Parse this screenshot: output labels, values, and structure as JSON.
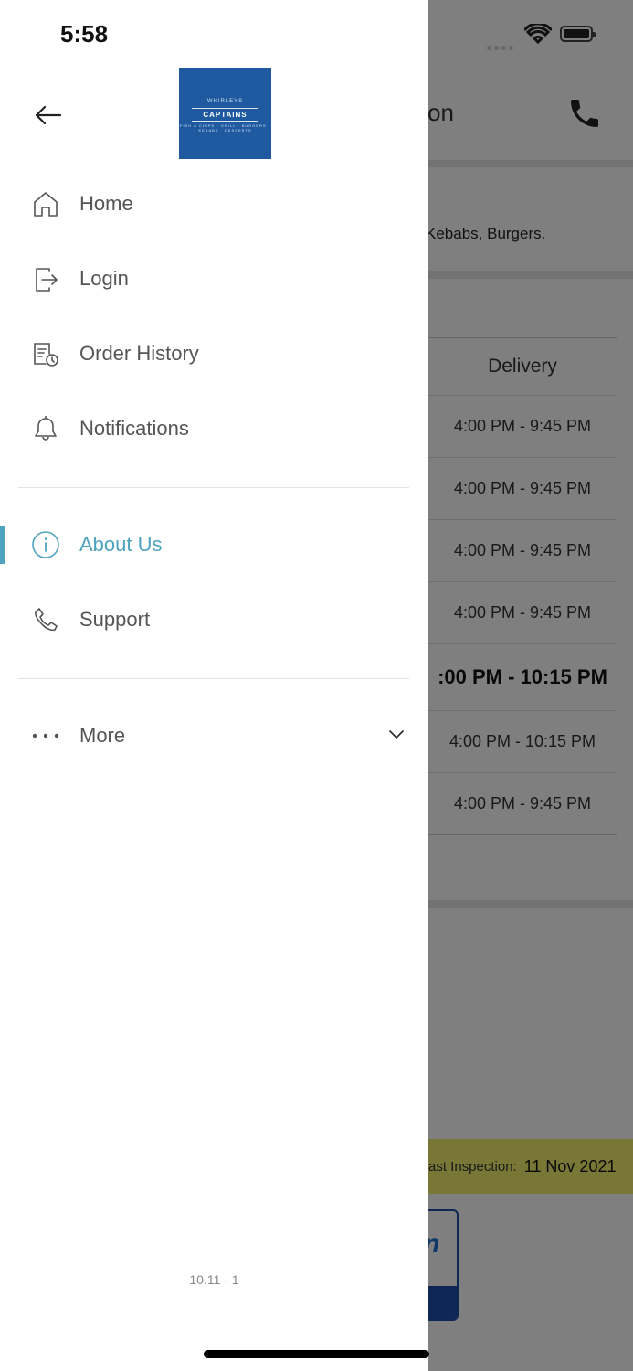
{
  "status_bar": {
    "time": "5:58"
  },
  "background": {
    "header_title_partial": "on",
    "cuisine_text": "Kebabs, Burgers.",
    "hours_header": "Delivery",
    "hours_rows": [
      "4:00 PM - 9:45 PM",
      "4:00 PM - 9:45 PM",
      "4:00 PM - 9:45 PM",
      "4:00 PM - 9:45 PM",
      ":00 PM - 10:15 PM",
      "4:00 PM - 10:15 PM",
      "4:00 PM - 9:45 PM"
    ],
    "inspection_label": "ast Inspection:",
    "inspection_date": "11 Nov 2021",
    "rating_letter": "n"
  },
  "drawer": {
    "logo": {
      "line1": "WHIRLEYS",
      "line2": "CAPTAINS",
      "line3": "FISH & CHIPS · GRILL · BURGERS · KEBABS · DESSERTS"
    },
    "menu": [
      {
        "label": "Home",
        "icon": "home-icon"
      },
      {
        "label": "Login",
        "icon": "login-icon"
      },
      {
        "label": "Order History",
        "icon": "order-history-icon"
      },
      {
        "label": "Notifications",
        "icon": "bell-icon"
      }
    ],
    "menu2": [
      {
        "label": "About Us",
        "icon": "info-icon",
        "active": true
      },
      {
        "label": "Support",
        "icon": "phone-icon"
      }
    ],
    "more_label": "More",
    "version": "10.11 - 1"
  },
  "colors": {
    "accent": "#4da3bd",
    "logo_bg": "#1f5aa0",
    "inspection_bg": "#f2ef6a"
  }
}
